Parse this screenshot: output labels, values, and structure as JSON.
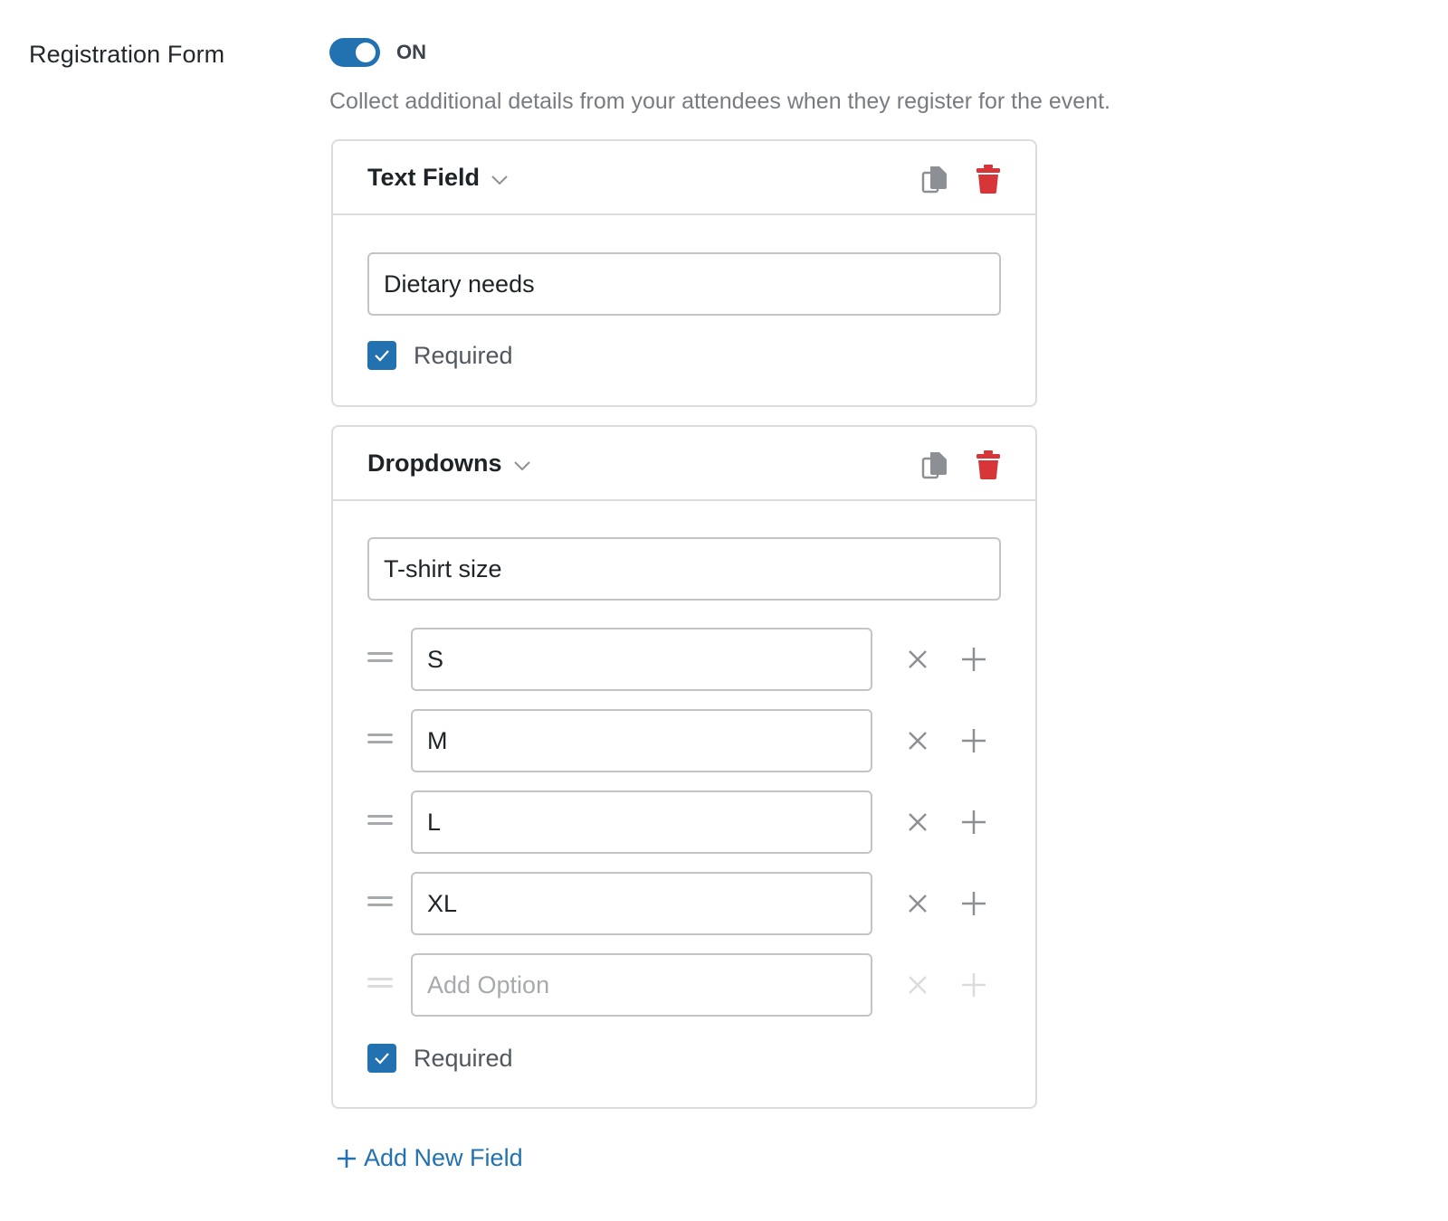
{
  "section": {
    "label": "Registration Form",
    "toggle_state": "ON",
    "description": "Collect additional details from your attendees when they register for the event."
  },
  "fields": [
    {
      "type_label": "Text Field",
      "label_value": "Dietary needs",
      "required_label": "Required",
      "required": true
    },
    {
      "type_label": "Dropdowns",
      "label_value": "T-shirt size",
      "options": [
        "S",
        "M",
        "L",
        "XL"
      ],
      "new_option_placeholder": "Add Option",
      "required_label": "Required",
      "required": true
    }
  ],
  "add_field_label": "Add New Field",
  "icons": {
    "toggle": "toggle-switch-icon",
    "chevron": "chevron-down-icon",
    "copy": "copy-icon",
    "delete": "trash-icon",
    "drag": "drag-handle-icon",
    "remove": "close-icon",
    "add": "plus-icon",
    "check": "checkmark-icon"
  },
  "colors": {
    "accent": "#2271b1",
    "danger": "#d63638",
    "muted": "#787c82",
    "border": "#dcdcde"
  }
}
